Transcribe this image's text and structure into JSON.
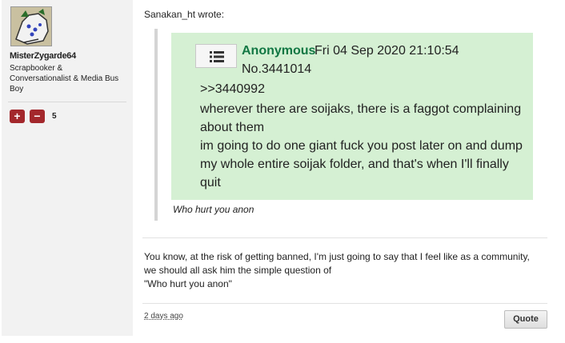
{
  "author": {
    "username": "MisterZygarde64",
    "title": "Scrapbooker & Conversationalist & Media Bus Boy",
    "reputation": "5",
    "avatar_icon": "zygarde-avatar-icon"
  },
  "reputation_buttons": {
    "plus": "+",
    "minus": "−"
  },
  "quote": {
    "author_line": "Sanakan_ht wrote:",
    "screenshot": {
      "poster": "Anonymous",
      "datetime": "Fri 04 Sep 2020 21:10:54",
      "post_no": "No.3441014",
      "reply_ref": ">>3440992",
      "body": "wherever there are soijaks, there is a faggot complaining about them\nim going to do one giant fuck you post later on and dump my whole entire soijak folder, and that's when I'll finally quit",
      "menu_icon": "menu-list-icon"
    },
    "text": "Who hurt you anon"
  },
  "post": {
    "body": "You know, at the risk of getting banned, I'm just going to say that I feel like as a community, we should all ask him the simple question of\n\"Who hurt you anon\"",
    "time": "2 days ago",
    "quote_button": "Quote"
  },
  "colors": {
    "rep_button": "#a3282c",
    "screenshot_bg": "#d5f0d3",
    "anon_name": "#117743"
  }
}
